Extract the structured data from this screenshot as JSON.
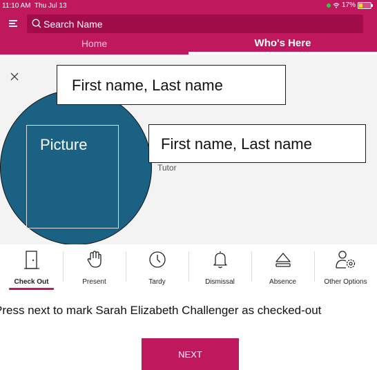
{
  "status_bar": {
    "time": "11:10 AM",
    "date": "Thu Jul 13",
    "battery": "17%"
  },
  "header": {
    "menu_icon": "menu-icon",
    "search": {
      "icon": "search-icon",
      "placeholder": "Search Name"
    },
    "tabs": [
      {
        "label": "Home",
        "active": false
      },
      {
        "label": "Who's Here",
        "active": true
      }
    ]
  },
  "card": {
    "close_icon": "close-icon",
    "picture_label": "Picture",
    "name_top": "First name, Last name",
    "name_right": "First name, Last name",
    "partial_text": "Tutor"
  },
  "options": [
    {
      "label": "Check Out",
      "icon": "door-exit-icon",
      "active": true
    },
    {
      "label": "Present",
      "icon": "raised-hand-icon",
      "active": false
    },
    {
      "label": "Tardy",
      "icon": "clock-icon",
      "active": false
    },
    {
      "label": "Dismissal",
      "icon": "bell-icon",
      "active": false
    },
    {
      "label": "Absence",
      "icon": "eject-icon",
      "active": false
    },
    {
      "label": "Other Options",
      "icon": "user-settings-icon",
      "active": false
    }
  ],
  "instruction": "Press next to mark Sarah Elizabeth Challenger as checked-out",
  "next_button": "NEXT",
  "colors": {
    "brand": "#c0185c",
    "search_bg": "#a10d49",
    "picture_bg": "#1b6183"
  }
}
